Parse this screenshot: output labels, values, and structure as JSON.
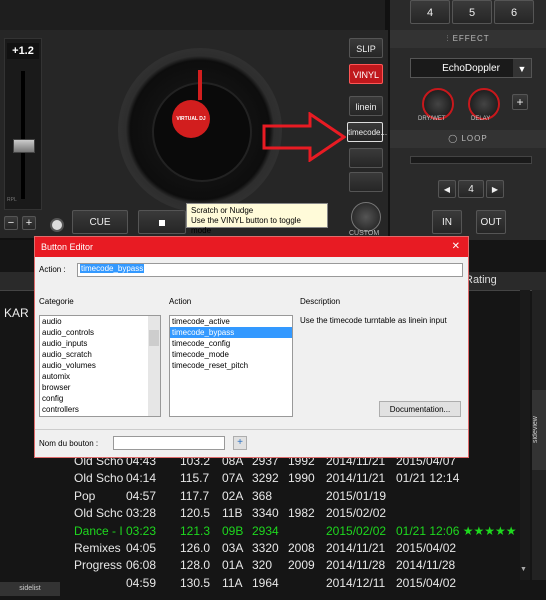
{
  "deck": {
    "pitch_value": "+1.2",
    "pitch_tiny_label": "RPL",
    "cue_label": "CUE",
    "platter_label": "VIRTUAL DJ",
    "slip_label": "SLIP",
    "vinyl_label": "VINYL",
    "linein_label": "linein",
    "timecode_label": "timecode...",
    "custom_label": "CUSTOM",
    "minus_label": "−",
    "plus_label": "+"
  },
  "tooltip": {
    "line1": "Scratch or Nudge",
    "line2": "Use the VINYL button to toggle mode"
  },
  "right_panel": {
    "num_buttons": [
      "4",
      "5",
      "6"
    ],
    "effect_header": "EFFECT",
    "effect_select": "EchoDoppler",
    "knob1_label": "DRY/WET",
    "knob2_label": "DELAY",
    "add_label": "+",
    "loop_header": "LOOP",
    "loop_value": "4",
    "in_label": "IN",
    "out_label": "OUT"
  },
  "browser": {
    "kar_text": "KAR",
    "rating_header": "Rating",
    "sideview_label": "sideview",
    "sidelist_label": "sidelist",
    "rows": [
      {
        "genre": "Old Scho",
        "time": "04:43",
        "bpm": "103.2",
        "key": "08A",
        "num": "2937",
        "year": "1992",
        "date1": "2014/11/21",
        "date2": "2015/04/07",
        "highlight": false
      },
      {
        "genre": "Old Scho",
        "time": "04:14",
        "bpm": "115.7",
        "key": "07A",
        "num": "3292",
        "year": "1990",
        "date1": "2014/11/21",
        "date2": "01/21 12:14",
        "highlight": false
      },
      {
        "genre": "Pop",
        "time": "04:57",
        "bpm": "117.7",
        "key": "02A",
        "num": "368",
        "year": "",
        "date1": "2015/01/19",
        "date2": "",
        "highlight": false
      },
      {
        "genre": "Old Schc",
        "time": "03:28",
        "bpm": "120.5",
        "key": "11B",
        "num": "3340",
        "year": "1982",
        "date1": "2015/02/02",
        "date2": "",
        "highlight": false
      },
      {
        "genre": "Dance - I",
        "time": "03:23",
        "bpm": "121.3",
        "key": "09B",
        "num": "2934",
        "year": "",
        "date1": "2015/02/02",
        "date2": "01/21 12:06 ★★★★★",
        "highlight": true
      },
      {
        "genre": "Remixes",
        "time": "04:05",
        "bpm": "126.0",
        "key": "03A",
        "num": "3320",
        "year": "2008",
        "date1": "2014/11/21",
        "date2": "2015/04/02",
        "highlight": false
      },
      {
        "genre": "Progress",
        "time": "06:08",
        "bpm": "128.0",
        "key": "01A",
        "num": "320",
        "year": "2009",
        "date1": "2014/11/28",
        "date2": "2014/11/28",
        "highlight": false
      },
      {
        "genre": "",
        "time": "04:59",
        "bpm": "130.5",
        "key": "11A",
        "num": "1964",
        "year": "",
        "date1": "2014/12/11",
        "date2": "2015/04/02",
        "highlight": false
      }
    ]
  },
  "dialog": {
    "title": "Button Editor",
    "close": "✕",
    "action_label": "Action :",
    "action_value": "timecode_bypass",
    "categorie_header": "Categorie",
    "action_header": "Action",
    "description_header": "Description",
    "categories": [
      "audio",
      "audio_controls",
      "audio_inputs",
      "audio_scratch",
      "audio_volumes",
      "automix",
      "browser",
      "config",
      "controllers"
    ],
    "actions": [
      "timecode_active",
      "timecode_bypass",
      "timecode_config",
      "timecode_mode",
      "timecode_reset_pitch"
    ],
    "selected_action_index": 1,
    "description_text": "Use the timecode turntable as linein input",
    "doc_button": "Documentation...",
    "name_label": "Nom du bouton :",
    "name_value": "",
    "add_button": "+"
  },
  "colors": {
    "accent_red": "#e81b23",
    "highlight_green": "#1ed81e",
    "selection_blue": "#3399ff"
  }
}
